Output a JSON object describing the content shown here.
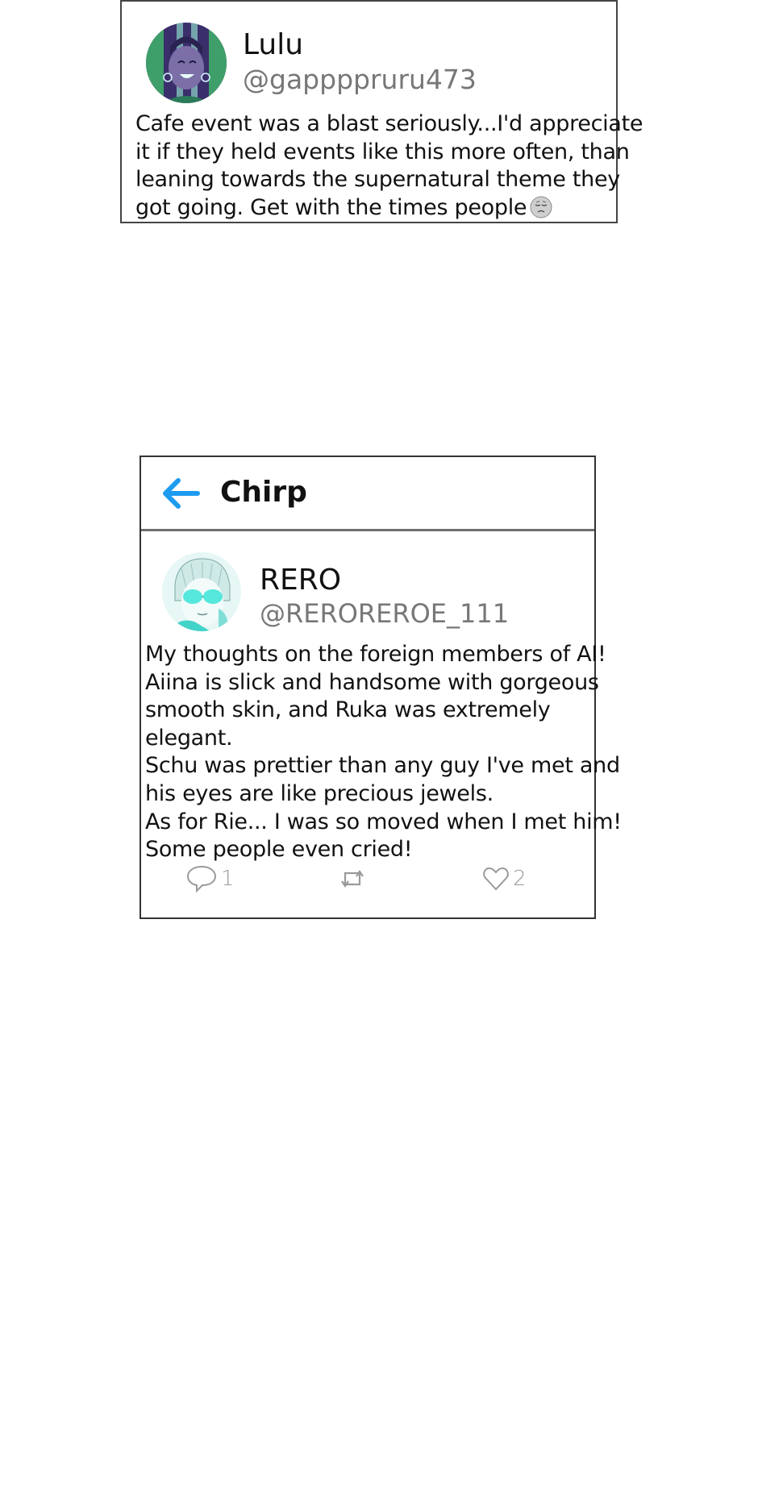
{
  "post_top": {
    "display_name": "Lulu",
    "handle": "@gappppruru473",
    "body_lines": [
      "Cafe event was a blast seriously...I'd appreciate",
      "it if they held events like this more often, than",
      "leaning towards the supernatural theme they",
      "got going. Get with the times people"
    ],
    "emoji": "pensive-face-icon"
  },
  "chirp_view": {
    "app_title": "Chirp",
    "back_icon": "back-arrow-icon",
    "accent_color": "#1d9bf0",
    "post": {
      "display_name": "RERO",
      "handle": "@REROREROE_111",
      "body_lines": [
        "My thoughts on the foreign members of AI!",
        "Aiina is slick and handsome with gorgeous",
        "smooth skin, and Ruka was extremely",
        "elegant.",
        "Schu was prettier than any guy I've met and",
        "his eyes are like precious jewels.",
        "As for Rie... I was so moved when I met him!",
        "Some people even cried!"
      ],
      "actions": {
        "reply_icon": "speech-bubble-icon",
        "reply_count": "1",
        "rechirp_icon": "repost-icon",
        "like_icon": "heart-icon",
        "like_count": "2"
      }
    }
  }
}
